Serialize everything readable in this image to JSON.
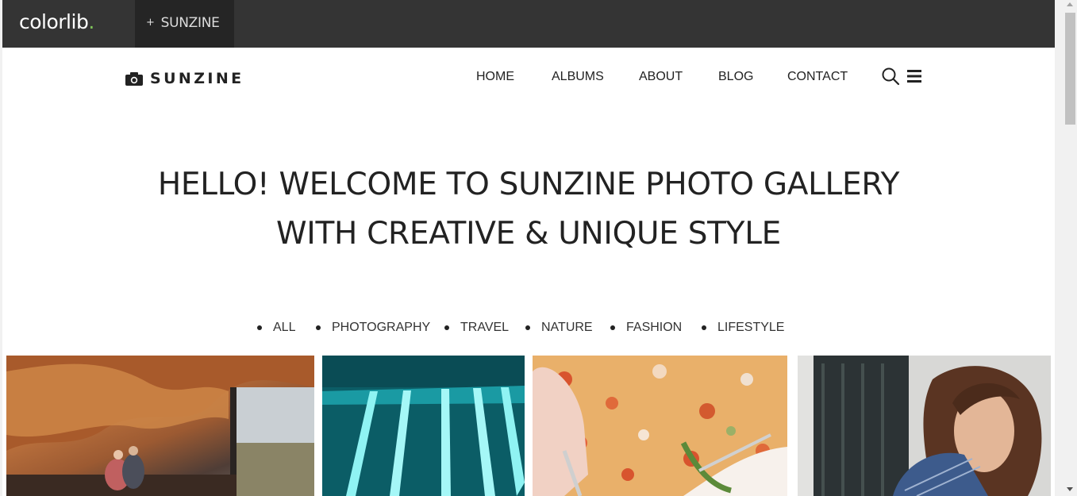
{
  "topbar": {
    "brand": "colorlib",
    "brand_dot": ".",
    "theme_tab_icon": "+",
    "theme_tab_label": "SUNZINE"
  },
  "header": {
    "logo_icon": "camera-icon",
    "logo_text": "SUNZINE",
    "nav": [
      {
        "label": "HOME"
      },
      {
        "label": "ALBUMS"
      },
      {
        "label": "ABOUT"
      },
      {
        "label": "BLOG"
      },
      {
        "label": "CONTACT"
      }
    ],
    "search_icon": "search-icon",
    "menu_icon": "hamburger-menu-icon"
  },
  "hero": {
    "line1": "HELLO! WELCOME TO SUNZINE PHOTO GALLERY",
    "line2": "WITH CREATIVE & UNIQUE STYLE"
  },
  "filters": [
    {
      "label": "ALL"
    },
    {
      "label": "PHOTOGRAPHY"
    },
    {
      "label": "TRAVEL"
    },
    {
      "label": "NATURE"
    },
    {
      "label": "FASHION"
    },
    {
      "label": "LIFESTYLE"
    }
  ],
  "gallery": [
    {
      "subject": "couple-in-wooden-cabin"
    },
    {
      "subject": "teal-light-stripes"
    },
    {
      "subject": "floral-plate-with-fork"
    },
    {
      "subject": "woman-portrait"
    }
  ],
  "colors": {
    "topbar_bg": "#343434",
    "theme_tab_bg": "#252525",
    "brand_accent": "#7fc45a",
    "text": "#222222"
  }
}
